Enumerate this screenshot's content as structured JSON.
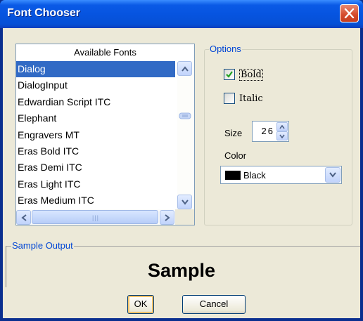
{
  "window": {
    "title": "Font Chooser",
    "icons": {
      "close": "close-icon"
    }
  },
  "fonts": {
    "header": "Available Fonts",
    "selected": "Dialog",
    "items": [
      "Dialog",
      "DialogInput",
      "Edwardian Script ITC",
      "Elephant",
      "Engravers MT",
      "Eras Bold ITC",
      "Eras Demi ITC",
      "Eras Light ITC",
      "Eras Medium ITC"
    ],
    "scrollbar": {
      "up_icon": "chevron-up-icon",
      "down_icon": "chevron-down-icon",
      "left_icon": "chevron-left-icon",
      "right_icon": "chevron-right-icon"
    }
  },
  "options": {
    "legend": "Options",
    "bold": {
      "label": "Bold",
      "checked": true
    },
    "italic": {
      "label": "Italic",
      "checked": false
    },
    "size": {
      "label": "Size",
      "value": "26"
    },
    "color": {
      "label": "Color",
      "value": "Black",
      "swatch": "#000000"
    }
  },
  "sample": {
    "legend": "Sample Output",
    "text": "Sample"
  },
  "buttons": {
    "ok": "OK",
    "cancel": "Cancel"
  },
  "colors": {
    "selection": "#316ac5",
    "group_legend": "#0046d5",
    "dialog_bg": "#ece9d8",
    "title_bar": "#0654e0"
  }
}
